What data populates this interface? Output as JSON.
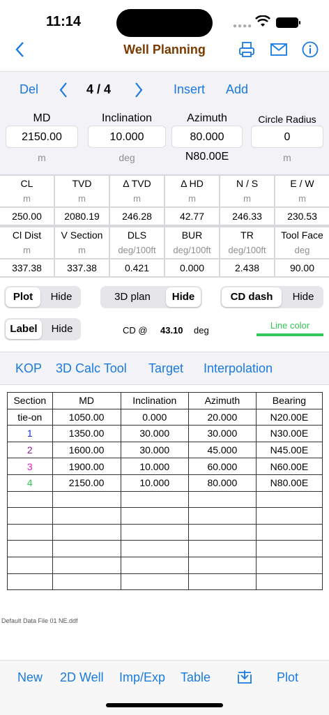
{
  "status": {
    "time": "11:14"
  },
  "nav": {
    "title": "Well Planning"
  },
  "toolbar": {
    "del": "Del",
    "page": "4 / 4",
    "insert": "Insert",
    "add": "Add"
  },
  "inputs": [
    {
      "label": "MD",
      "value": "2150.00",
      "unit": "m"
    },
    {
      "label": "Inclination",
      "value": "10.000",
      "unit": "deg"
    },
    {
      "label": "Azimuth",
      "value": "80.000",
      "unit": "N80.00E"
    },
    {
      "label": "Circle Radius",
      "value": "0",
      "unit": "m"
    }
  ],
  "grid1": [
    {
      "label": "CL",
      "unit": "m",
      "value": "250.00"
    },
    {
      "label": "TVD",
      "unit": "m",
      "value": "2080.19"
    },
    {
      "label": "Δ TVD",
      "unit": "m",
      "value": "246.28"
    },
    {
      "label": "Δ HD",
      "unit": "m",
      "value": "42.77"
    },
    {
      "label": "N / S",
      "unit": "m",
      "value": "246.33"
    },
    {
      "label": "E / W",
      "unit": "m",
      "value": "230.53"
    }
  ],
  "grid2": [
    {
      "label": "Cl Dist",
      "unit": "m",
      "value": "337.38"
    },
    {
      "label": "V Section",
      "unit": "m",
      "value": "337.38"
    },
    {
      "label": "DLS",
      "unit": "deg/100ft",
      "value": "0.421"
    },
    {
      "label": "BUR",
      "unit": "deg/100ft",
      "value": "0.000"
    },
    {
      "label": "TR",
      "unit": "deg/100ft",
      "value": "2.438"
    },
    {
      "label": "Tool Face",
      "unit": "deg",
      "value": "90.00"
    }
  ],
  "controls": {
    "plot": "Plot",
    "hide": "Hide",
    "plan3d": "3D plan",
    "cddash": "CD dash",
    "label": "Label",
    "cd_at": "CD @",
    "cd_value": "43.10",
    "cd_unit": "deg",
    "line_color": "Line color",
    "line_color_hex": "#34c759"
  },
  "links": {
    "kop": "KOP",
    "calc3d": "3D Calc Tool",
    "target": "Target",
    "interp": "Interpolation"
  },
  "table": {
    "headers": [
      "Section",
      "MD",
      "Inclination",
      "Azimuth",
      "Bearing"
    ],
    "rows": [
      [
        "tie-on",
        "1050.00",
        "0.000",
        "20.000",
        "N20.00E"
      ],
      [
        "1",
        "1350.00",
        "30.000",
        "30.000",
        "N30.00E"
      ],
      [
        "2",
        "1600.00",
        "30.000",
        "45.000",
        "N45.00E"
      ],
      [
        "3",
        "1900.00",
        "10.000",
        "60.000",
        "N60.00E"
      ],
      [
        "4",
        "2150.00",
        "10.000",
        "80.000",
        "N80.00E"
      ]
    ],
    "section_colors": [
      "#000000",
      "#1a2ee0",
      "#8e1a9e",
      "#e01ad0",
      "#34c759"
    ]
  },
  "file": "Default Data File 01 NE.ddf",
  "tabbar": {
    "new": "New",
    "well2d": "2D Well",
    "impexp": "Imp/Exp",
    "table": "Table",
    "plot": "Plot"
  }
}
